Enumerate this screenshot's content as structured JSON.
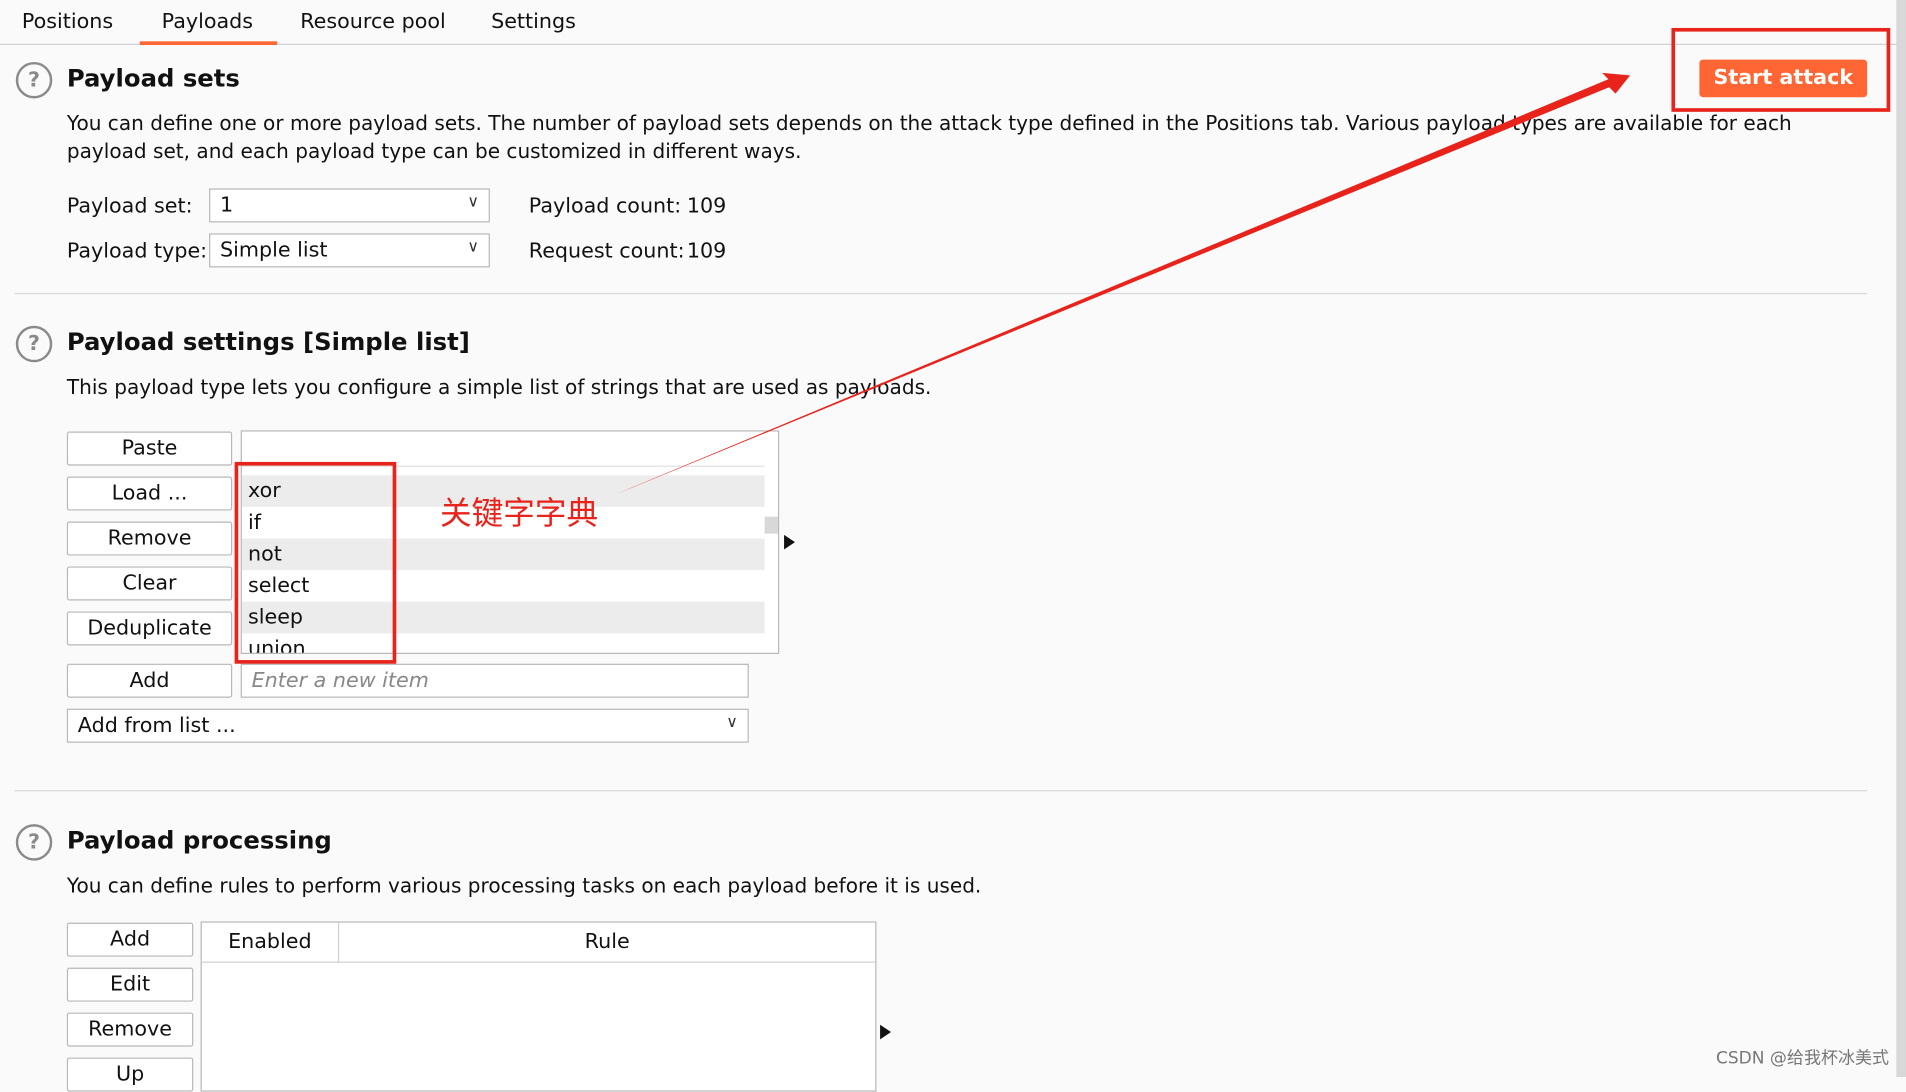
{
  "tabs": [
    "Positions",
    "Payloads",
    "Resource pool",
    "Settings"
  ],
  "active_tab": "Payloads",
  "start_attack": "Start attack",
  "payload_sets": {
    "title": "Payload sets",
    "description_line1": "You can define one or more payload sets. The number of payload sets depends on the attack type defined in the Positions tab. Various payload types are available for each",
    "description_line2": "payload set, and each payload type can be customized in different ways.",
    "set_label": "Payload set:",
    "set_value": "1",
    "type_label": "Payload type:",
    "type_value": "Simple list",
    "payload_count_label": "Payload count:",
    "payload_count": "109",
    "request_count_label": "Request count:",
    "request_count": "109"
  },
  "payload_settings": {
    "title": "Payload settings [Simple list]",
    "description": "This payload type lets you configure a simple list of strings that are used as payloads.",
    "buttons": [
      "Paste",
      "Load ...",
      "Remove",
      "Clear",
      "Deduplicate"
    ],
    "items": [
      "",
      "xor",
      "if",
      "not",
      "select",
      "sleep",
      "union"
    ],
    "add_button": "Add",
    "new_item_placeholder": "Enter a new item",
    "add_from_list": "Add from list ...",
    "annotation": "关键字字典"
  },
  "payload_processing": {
    "title": "Payload processing",
    "description": "You can define rules to perform various processing tasks on each payload before it is used.",
    "buttons": [
      "Add",
      "Edit",
      "Remove",
      "Up"
    ],
    "columns": [
      "Enabled",
      "Rule"
    ]
  },
  "watermark": "CSDN @给我杯冰美式",
  "colors": {
    "accent": "#ff6633",
    "annotation_red": "#e8231b"
  },
  "icons": {
    "help": "question-circle-icon",
    "dropdown": "chevron-down-icon",
    "expand": "triangle-right-icon"
  }
}
